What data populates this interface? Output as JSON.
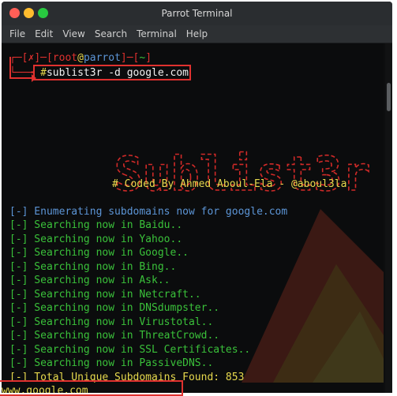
{
  "window": {
    "title": "Parrot Terminal"
  },
  "menu": [
    "File",
    "Edit",
    "View",
    "Search",
    "Terminal",
    "Help"
  ],
  "prompt": {
    "x_mark": "✗",
    "user": "root",
    "at": "@",
    "host": "parrot",
    "path": "~",
    "symbol": "#",
    "command": "sublist3r -d google.com"
  },
  "banner": {
    "art_text": "Sublist3r",
    "coded_by": "# Coded By Ahmed Aboul-Ela - @aboul3la"
  },
  "output": {
    "enumerating": "[-] Enumerating subdomains now for google.com",
    "searches": [
      "[-] Searching now in Baidu..",
      "[-] Searching now in Yahoo..",
      "[-] Searching now in Google..",
      "[-] Searching now in Bing..",
      "[-] Searching now in Ask..",
      "[-] Searching now in Netcraft..",
      "[-] Searching now in DNSdumpster..",
      "[-] Searching now in Virustotal..",
      "[-] Searching now in ThreatCrowd..",
      "[-] Searching now in SSL Certificates..",
      "[-] Searching now in PassiveDNS.."
    ],
    "total": "[-] Total Unique Subdomains Found: 853",
    "first_result": "www.google.com"
  },
  "colors": {
    "accent_red": "#e0312f",
    "yellow": "#e7d94d",
    "blue": "#5c95d6",
    "green": "#3ac13a"
  }
}
